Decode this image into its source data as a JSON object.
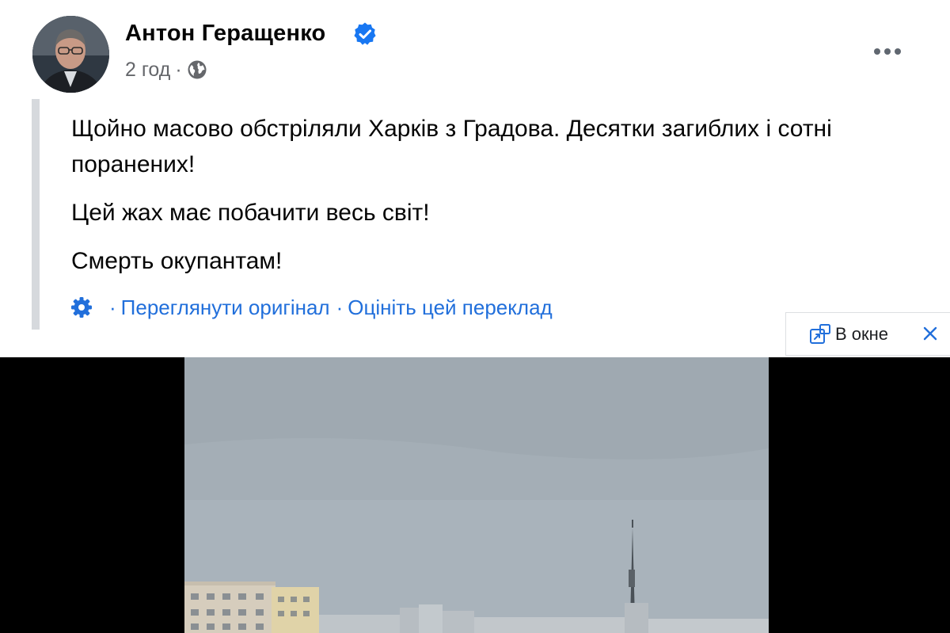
{
  "post": {
    "author": "Антон Геращенко",
    "time": "2 год",
    "meta_separator": "·",
    "icons": {
      "verified": "verified-badge-icon",
      "audience": "globe-icon",
      "more": "more-options-icon"
    },
    "paragraphs": [
      "Щойно масово обстріляли Харків з Градова. Десятки загиблих і сотні поранених!",
      "Цей жах має побачити весь світ!",
      "Смерть окупантам!"
    ],
    "translation": {
      "separator": "·",
      "view_original": "Переглянути оригінал",
      "rate": "Оцініть цей переклад",
      "icon": "gear-icon"
    }
  },
  "pip": {
    "label": "В окне",
    "icon": "picture-in-picture-icon",
    "close_icon": "close-icon"
  },
  "colors": {
    "link": "#216fdb",
    "meta": "#65676b",
    "verified": "#1877f2",
    "video_background": "#000000"
  }
}
